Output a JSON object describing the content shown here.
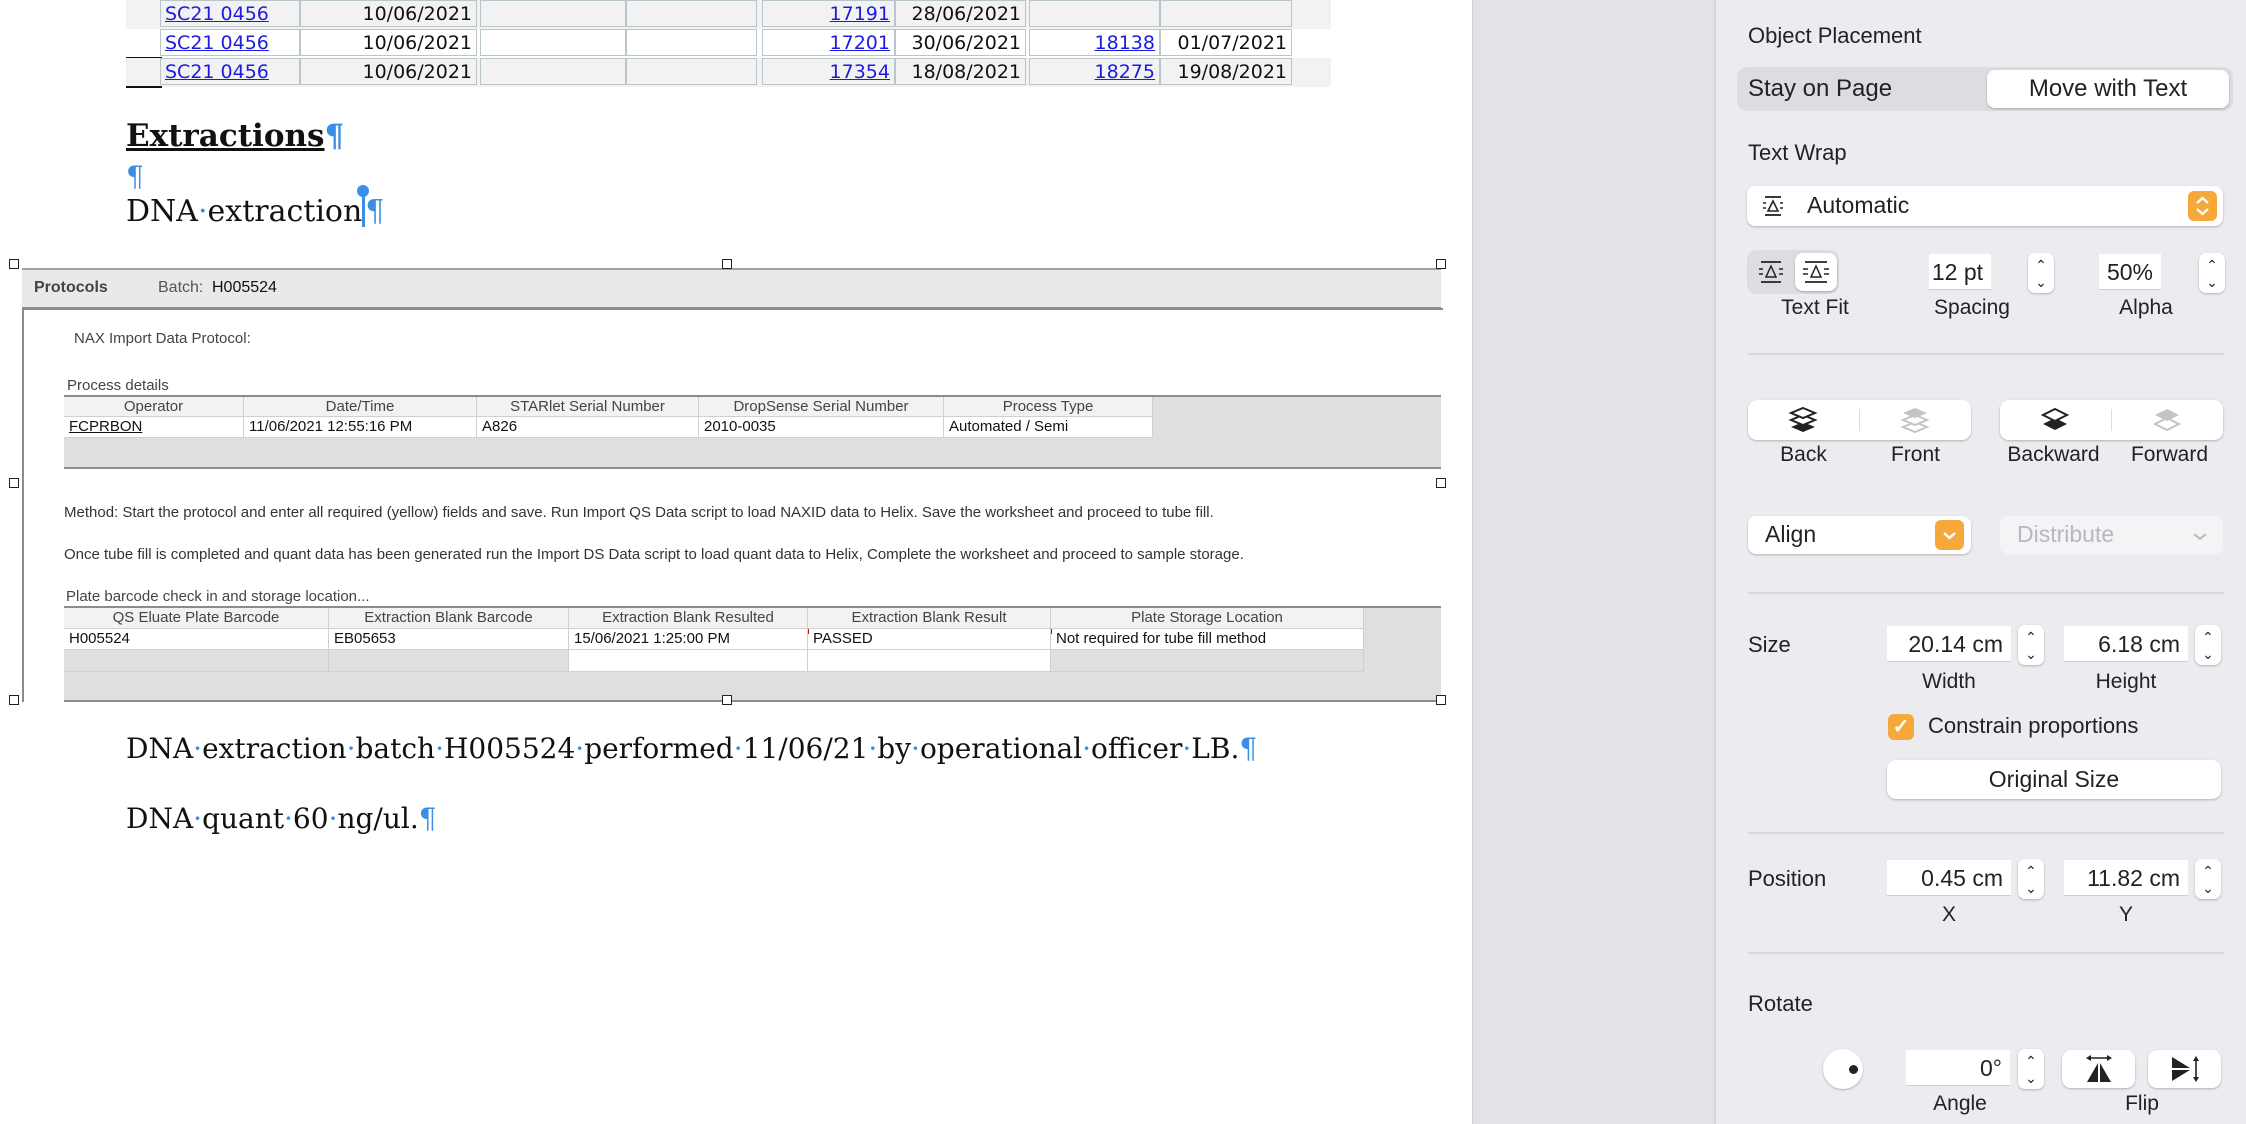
{
  "document": {
    "top_table": {
      "rows": [
        {
          "sample": "SC21 0456",
          "date1": "10/06/2021",
          "c3": "",
          "c4": "",
          "link2": "17191",
          "date2": "28/06/2021",
          "link3": "",
          "date3": ""
        },
        {
          "sample": "SC21 0456",
          "date1": "10/06/2021",
          "c3": "",
          "c4": "",
          "link2": "17201",
          "date2": "30/06/2021",
          "link3": "18138",
          "date3": "01/07/2021"
        },
        {
          "sample": "SC21 0456",
          "date1": "10/06/2021",
          "c3": "",
          "c4": "",
          "link2": "17354",
          "date2": "18/08/2021",
          "link3": "18275",
          "date3": "19/08/2021"
        }
      ]
    },
    "heading": "Extractions",
    "pilcrow": "¶",
    "space_dot": "·",
    "dna_title_words": [
      "DNA",
      "extraction"
    ],
    "embedded_image": {
      "header": {
        "title": "Protocols",
        "batch_label": "Batch:",
        "batch_value": "H005524"
      },
      "protocol_title": "NAX Import Data Protocol:",
      "process_details_label": "Process details",
      "process_table": {
        "headers": [
          "Operator",
          "Date/Time",
          "STARlet Serial Number",
          "DropSense Serial Number",
          "Process Type"
        ],
        "row": [
          "FCPRBON",
          "11/06/2021 12:55:16 PM",
          "A826",
          "2010-0035",
          "Automated / Semi"
        ]
      },
      "method_text": "Method: Start the protocol and enter all required (yellow) fields and save. Run Import QS Data script to load  NAXID data to Helix. Save the worksheet and proceed to tube fill.",
      "once_text": "Once tube fill is completed and quant data has been generated run the Import DS Data  script to load quant data to Helix, Complete the worksheet and proceed to sample storage.",
      "plate_label": "Plate barcode check in and storage location...",
      "plate_table": {
        "headers": [
          "QS Eluate Plate Barcode",
          "Extraction Blank Barcode",
          "Extraction Blank Resulted",
          "Extraction Blank Result",
          "Plate Storage Location"
        ],
        "row": [
          "H005524",
          "EB05653",
          "15/06/2021 1:25:00 PM",
          "PASSED",
          "Not required for tube fill method"
        ]
      }
    },
    "paragraph1_words": [
      "DNA",
      "extraction",
      "batch",
      "H005524",
      "performed",
      "11/06/21",
      "by",
      "operational",
      "officer",
      "LB."
    ],
    "paragraph2_words": [
      "DNA",
      "quant",
      "60",
      "ng/ul."
    ]
  },
  "panel": {
    "object_placement": {
      "label": "Object Placement",
      "options": [
        "Stay on Page",
        "Move with Text"
      ],
      "selected": "Move with Text"
    },
    "text_wrap": {
      "label": "Text Wrap",
      "value": "Automatic",
      "text_fit_label": "Text Fit",
      "spacing_value": "12 pt",
      "spacing_label": "Spacing",
      "alpha_value": "50%",
      "alpha_label": "Alpha"
    },
    "arrange": {
      "back": "Back",
      "front": "Front",
      "backward": "Backward",
      "forward": "Forward"
    },
    "align_label": "Align",
    "distribute_label": "Distribute",
    "size": {
      "label": "Size",
      "width_value": "20.14 cm",
      "width_label": "Width",
      "height_value": "6.18 cm",
      "height_label": "Height",
      "constrain_label": "Constrain proportions",
      "constrain_checked": true,
      "original_size_label": "Original Size"
    },
    "position": {
      "label": "Position",
      "x_value": "0.45 cm",
      "x_label": "X",
      "y_value": "11.82 cm",
      "y_label": "Y"
    },
    "rotate": {
      "label": "Rotate",
      "angle_value": "0°",
      "angle_label": "Angle",
      "flip_label": "Flip"
    },
    "colors": {
      "accent": "#f6a93a",
      "link": "#1c1ce0",
      "pilcrow": "#3a8ee6"
    }
  }
}
